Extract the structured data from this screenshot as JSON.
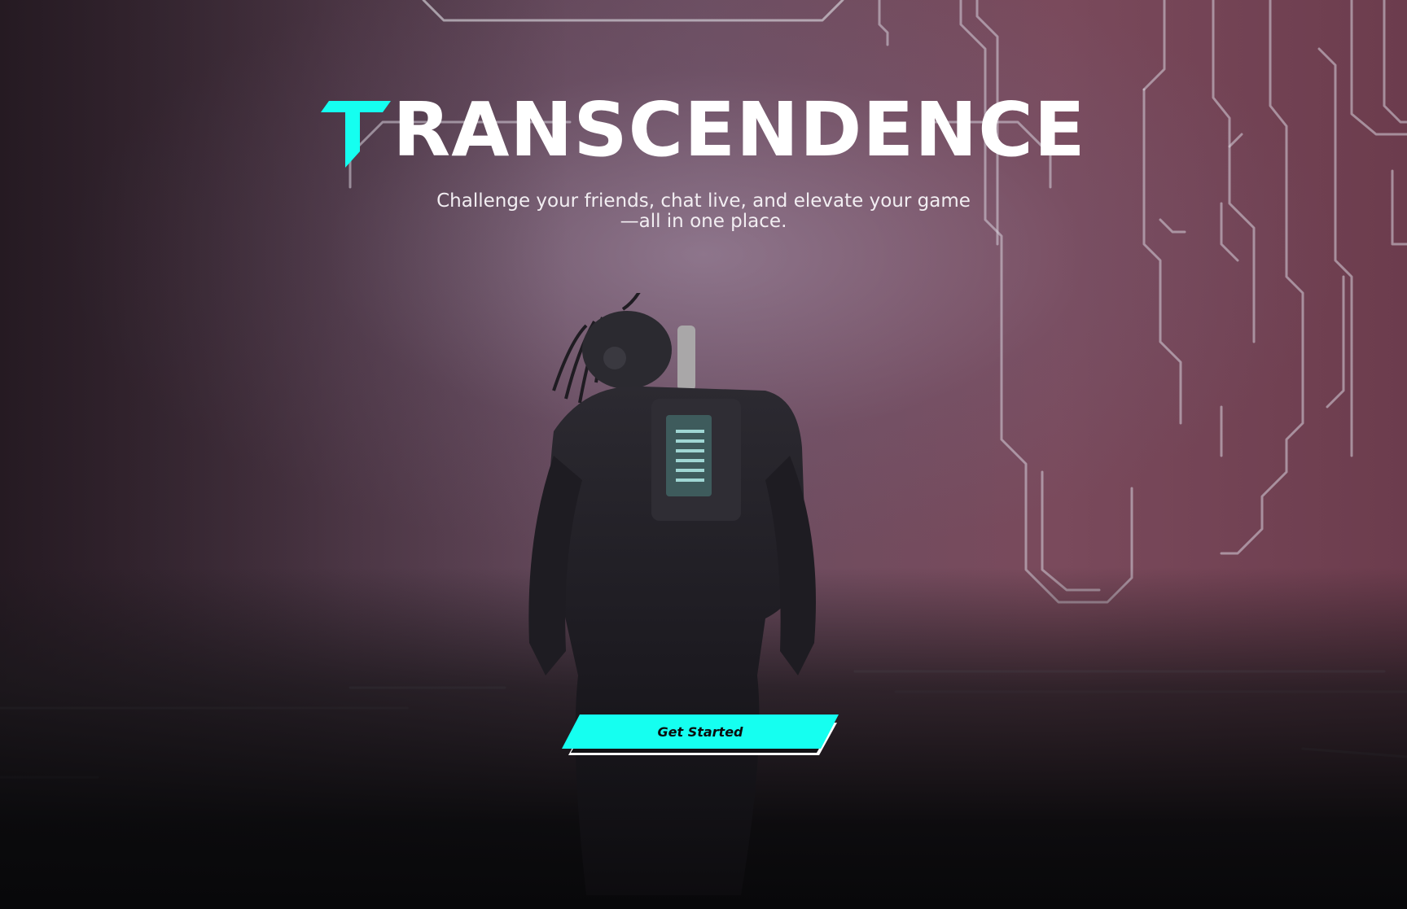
{
  "hero": {
    "brand_initial": "T",
    "brand_rest": "RANSCENDENCE",
    "tagline": "Challenge your friends, chat live, and elevate your game —all in one place."
  },
  "cta": {
    "label": "Get Started"
  },
  "colors": {
    "accent": "#15FFF0",
    "title": "#FFFFFF",
    "tagline": "#F2EEF2",
    "background_top": "#6B4D60",
    "background_bottom": "#08080A"
  },
  "icons": {
    "logo": "logo-t-icon"
  }
}
